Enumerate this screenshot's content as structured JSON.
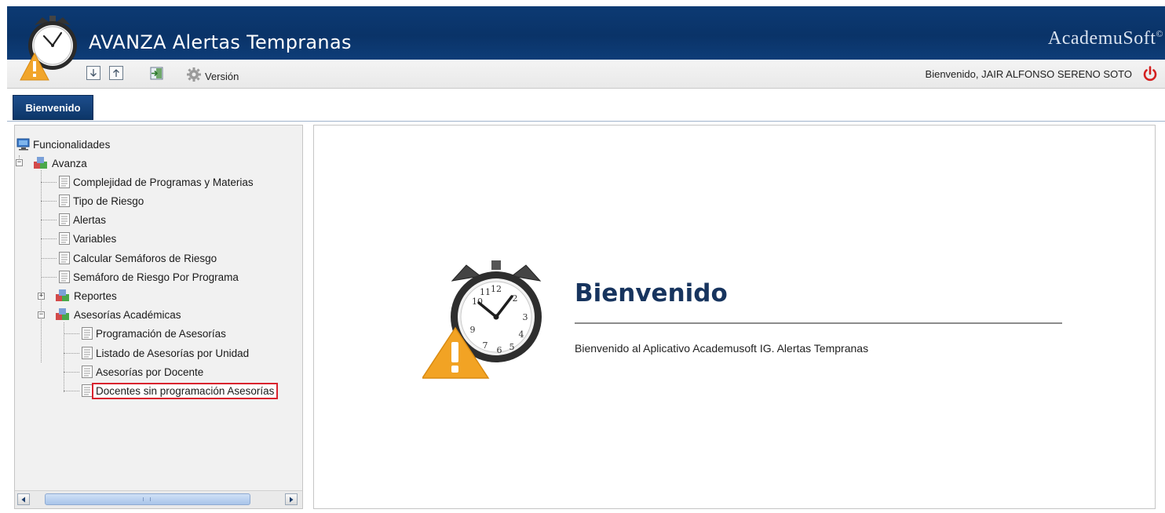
{
  "header": {
    "app_title": "AVANZA Alertas Tempranas",
    "brand": "AcademuSoft",
    "brand_mark": "©"
  },
  "toolbar": {
    "version_label": "Versión",
    "welcome_user": "Bienvenido, JAIR ALFONSO SERENO SOTO"
  },
  "tabs": [
    {
      "label": "Bienvenido",
      "active": true
    }
  ],
  "tree": {
    "root": "Funcionalidades",
    "avanza": {
      "label": "Avanza",
      "items": [
        "Complejidad de Programas y Materias",
        "Tipo de Riesgo",
        "Alertas",
        "Variables",
        "Calcular Semáforos de Riesgo",
        "Semáforo de Riesgo Por Programa"
      ],
      "reportes": "Reportes",
      "asesorias": {
        "label": "Asesorías Académicas",
        "items": [
          "Programación de Asesorías",
          "Listado de Asesorías por Unidad",
          "Asesorías por Docente",
          "Docentes sin programación Asesorías"
        ]
      }
    },
    "selected": "Docentes sin programación Asesorías"
  },
  "main": {
    "heading": "Bienvenido",
    "text": "Bienvenido al Aplicativo Academusoft IG. Alertas Tempranas"
  },
  "colors": {
    "header_bg": "#0a3368",
    "heading": "#17345e",
    "selection_outline": "#d9232e",
    "power_icon": "#d42020"
  },
  "icons": {
    "logo": "alarm-clock-warning-icon",
    "download": "arrow-down-icon",
    "upload": "arrow-up-icon",
    "exit": "exit-door-icon",
    "version": "gear-icon",
    "power": "power-icon",
    "root": "monitor-icon",
    "module": "cubes-icon",
    "page": "document-icon"
  }
}
